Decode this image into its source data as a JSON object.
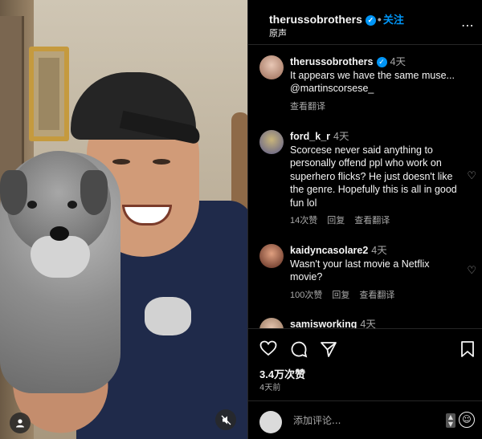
{
  "header": {
    "username": "therussobrothers",
    "follow_label": "关注",
    "audio_label": "原声",
    "more_icon": "more-icon"
  },
  "comments": [
    {
      "username": "therussobrothers",
      "time": "4天",
      "text": "It appears we have the same muse... @martinscorsese_",
      "translate": "查看翻译",
      "verified": true,
      "avatar_color": "#c9a08a"
    },
    {
      "username": "ford_k_r",
      "time": "4天",
      "text": "Scorcese never said anything to personally offend ppl who work on superhero flicks? He just doesn't like the genre. Hopefully this is all in good fun lol",
      "likes": "14次赞",
      "reply": "回复",
      "translate": "查看翻译",
      "avatar_color": "#8a7a55"
    },
    {
      "username": "kaidyncasolare2",
      "time": "4天",
      "text": "Wasn't your last movie a Netflix movie?",
      "likes": "100次赞",
      "reply": "回复",
      "translate": "查看翻译",
      "avatar_color": "#7c3b2a"
    },
    {
      "username": "samisworking",
      "time": "4天",
      "avatar_color": "#b48a6e"
    }
  ],
  "actions": {
    "likes_count": "3.4万次赞",
    "posted_ago": "4天前"
  },
  "composer": {
    "placeholder": "添加评论..."
  },
  "colors": {
    "accent": "#0095f6",
    "background": "#000000",
    "secondary_text": "#a8a8a8"
  }
}
